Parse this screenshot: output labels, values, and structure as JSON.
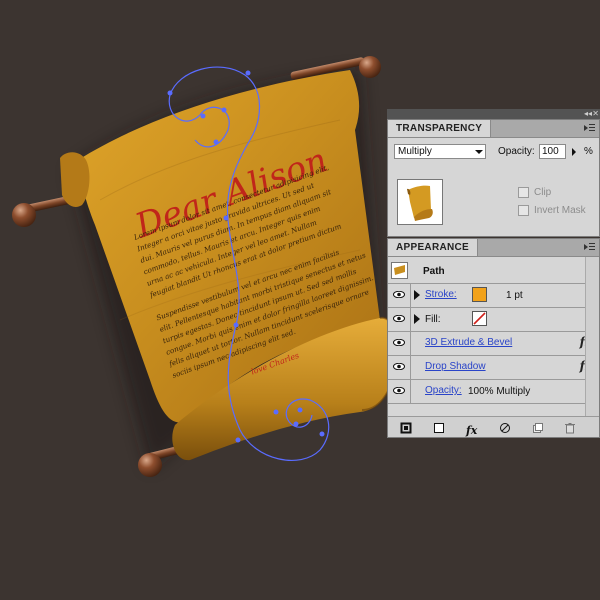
{
  "colors": {
    "background": "#3c3430",
    "parchment": "#c8901f",
    "path_stroke": "#5a6cff",
    "title_red": "#c0261a",
    "stroke_swatch": "#f2a21a",
    "link_blue": "#2a44c8"
  },
  "artwork": {
    "title": "Dear Alison",
    "body_lines": [
      "Lorem ipsum dolor sit amet, consectetur adipisicing elit,",
      "Integer a orci vitae justo gravida ultrices. Ut sed ut",
      "dui. Mauris vel purus diam. In tempus diam aliquam sit",
      "commodo, tellus. Mauris et arcu. Integer quis enim",
      "urna ac ac vehicula. Integer vel leo amet. Nullam",
      "feugiat blandit Ut rhoncus erat at dolor pretium dictum",
      "",
      "Suspendisse vestibulum vel et arcu nec enim facilisis",
      "elit. Pellentesque habitant morbi tristique senectus et netus",
      "turpis egestas. Donec tincidunt ipsum ut. Sed sed mollis",
      "congue. Morbi quis enim et dolor fringilla laoreet dignissim.",
      "felis aliquet ut tortor. Nullam tincidunt scelerisque ornare",
      "sociis ipsum nec adipiscing elit sed."
    ],
    "signature": "love Charles"
  },
  "transparency_panel": {
    "tab_label": "TRANSPARENCY",
    "blend_mode": "Multiply",
    "opacity_label": "Opacity:",
    "opacity_value": "100",
    "percent": "%",
    "clip_label": "Clip",
    "invert_mask_label": "Invert Mask"
  },
  "appearance_panel": {
    "tab_label": "APPEARANCE",
    "object_type": "Path",
    "stroke_label": "Stroke:",
    "stroke_weight": "1 pt",
    "fill_label": "Fill:",
    "effect_1": "3D Extrude & Bevel",
    "effect_2": "Drop Shadow",
    "opacity_label": "Opacity:",
    "opacity_value": "100% Multiply",
    "fx_symbol": "fx"
  },
  "icons": {
    "panel_menu": "panel-menu-icon",
    "collapse": "collapse-icon",
    "close": "close-icon",
    "visibility": "eye-icon",
    "new_stroke": "new-stroke-icon",
    "new_fill": "new-fill-icon",
    "add_effect": "fx-icon",
    "clear": "clear-appearance-icon",
    "duplicate": "duplicate-item-icon",
    "delete": "trash-icon"
  }
}
